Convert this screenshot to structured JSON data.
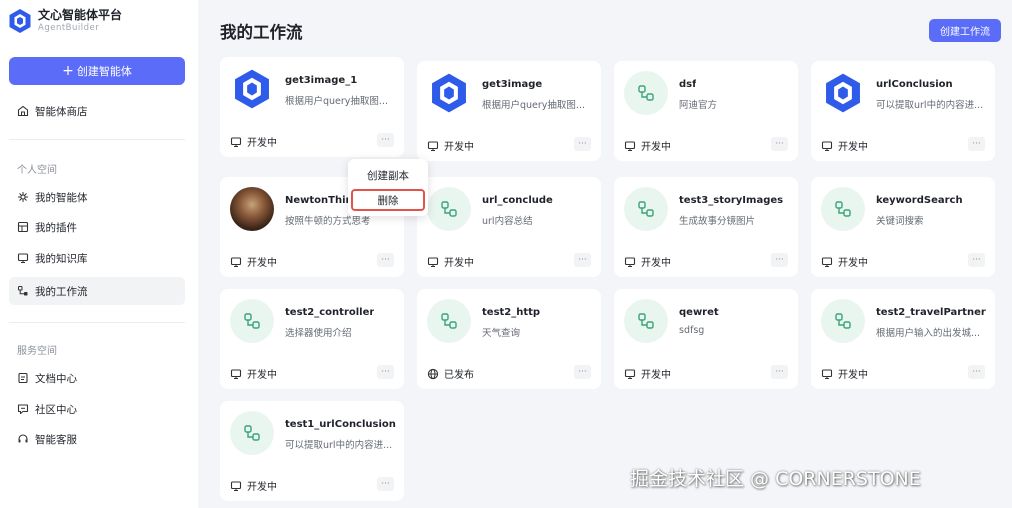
{
  "brand": {
    "title": "文心智能体平台",
    "subtitle": "AgentBuilder"
  },
  "sidebar": {
    "create_label": "创建智能体",
    "store_label": "智能体商店",
    "personal_section": "个人空间",
    "personal_items": [
      {
        "label": "我的智能体",
        "icon": "sparkle-icon"
      },
      {
        "label": "我的插件",
        "icon": "plugin-icon"
      },
      {
        "label": "我的知识库",
        "icon": "knowledge-icon"
      },
      {
        "label": "我的工作流",
        "icon": "workflow-icon"
      }
    ],
    "service_section": "服务空间",
    "service_items": [
      {
        "label": "文档中心",
        "icon": "document-icon"
      },
      {
        "label": "社区中心",
        "icon": "chat-icon"
      },
      {
        "label": "智能客服",
        "icon": "headset-icon"
      }
    ]
  },
  "header": {
    "title": "我的工作流",
    "create_button": "创建工作流"
  },
  "cards": [
    {
      "name": "get3image_1",
      "desc": "根据用户query抽取图...",
      "status": "开发中",
      "more": "···",
      "icon": "logo"
    },
    {
      "name": "get3image",
      "desc": "根据用户query抽取图...",
      "status": "开发中",
      "more": "···",
      "icon": "logo"
    },
    {
      "name": "dsf",
      "desc": "阿迪官方",
      "status": "开发中",
      "more": "···",
      "icon": "workflow"
    },
    {
      "name": "urlConclusion",
      "desc": "可以提取url中的内容进...",
      "status": "开发中",
      "more": "···",
      "icon": "logo"
    },
    {
      "name": "NewtonThink",
      "desc": "按照牛顿的方式思考",
      "status": "开发中",
      "more": "···",
      "icon": "avatar"
    },
    {
      "name": "url_conclude",
      "desc": "url内容总结",
      "status": "开发中",
      "more": "···",
      "icon": "workflow"
    },
    {
      "name": "test3_storyImages",
      "desc": "生成故事分镜图片",
      "status": "开发中",
      "more": "···",
      "icon": "workflow"
    },
    {
      "name": "keywordSearch",
      "desc": "关键词搜索",
      "status": "开发中",
      "more": "···",
      "icon": "workflow"
    },
    {
      "name": "test2_controller",
      "desc": "选择器使用介绍",
      "status": "开发中",
      "more": "···",
      "icon": "workflow"
    },
    {
      "name": "test2_http",
      "desc": "天气查询",
      "status": "已发布",
      "more": "···",
      "icon": "workflow"
    },
    {
      "name": "qewret",
      "desc": "sdfsg",
      "status": "开发中",
      "more": "···",
      "icon": "workflow"
    },
    {
      "name": "test2_travelPartner",
      "desc": "根据用户输入的出发城...",
      "status": "开发中",
      "more": "···",
      "icon": "workflow"
    },
    {
      "name": "test1_urlConclusion",
      "desc": "可以提取url中的内容进...",
      "status": "开发中",
      "more": "···",
      "icon": "workflow"
    }
  ],
  "context_menu": {
    "copy_label": "创建副本",
    "delete_label": "删除"
  },
  "watermark": "掘金技术社区 @ CORNERSTONE",
  "colors": {
    "accent": "#5b6cf9",
    "workflow_bg": "#e9f6ef",
    "workflow_green": "#3aa37a",
    "delete_border": "#e2534b"
  }
}
